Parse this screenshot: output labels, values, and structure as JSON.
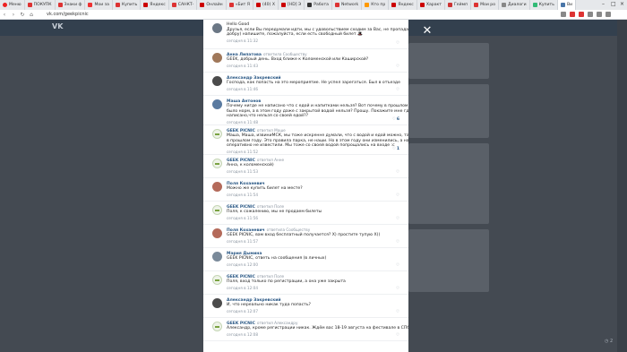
{
  "browser": {
    "menu_label": "Меню",
    "tabs": [
      {
        "label": "ПОКУПК",
        "color": "#d33"
      },
      {
        "label": "Знаки ф",
        "color": "#d33"
      },
      {
        "label": "Мои за",
        "color": "#e33"
      },
      {
        "label": "Купить",
        "color": "#d33"
      },
      {
        "label": "Яндекс",
        "color": "#c00"
      },
      {
        "label": "САНКТ-",
        "color": "#d33"
      },
      {
        "label": "Онлайн",
        "color": "#c00"
      },
      {
        "label": "«Бит Я",
        "color": "#d33"
      },
      {
        "label": "(40) Х",
        "color": "#c00"
      },
      {
        "label": "[HD] Э",
        "color": "#c00"
      },
      {
        "label": "Работа",
        "color": "#333"
      },
      {
        "label": "Network",
        "color": "#d33"
      },
      {
        "label": "Кто пр",
        "color": "#f90"
      },
      {
        "label": "Яндекс",
        "color": "#c00"
      },
      {
        "label": "Характ",
        "color": "#c00"
      },
      {
        "label": "Геймп",
        "color": "#c33"
      },
      {
        "label": "Мои ро",
        "color": "#d33"
      },
      {
        "label": "Диалоги",
        "color": "#888"
      },
      {
        "label": "Купить",
        "color": "#3b7"
      },
      {
        "label": "Ви",
        "color": "#4a76a8"
      }
    ],
    "url": "vk.com/geekpicnic"
  },
  "modal": {
    "comments": [
      {
        "name": "",
        "text": [
          "Hello Good",
          "Друзья, если Вы передумали идти, мы с удовольствием сходим за Вас, не пропадать же",
          "добру) напишите, пожалуйста, если есть свободный билет 🎩"
        ],
        "date": "сегодня в 11:32",
        "avatar": "#6b7785",
        "likes": ""
      },
      {
        "name": "Анна Липатова",
        "answer": "ответила Сообществу",
        "text": [
          "GEEK, добрый день. Вход ближе к Коломенской или Каширской?"
        ],
        "date": "сегодня в 11:43",
        "avatar": "#a0785a",
        "likes": ""
      },
      {
        "name": "Александр Закревский",
        "text": [
          "Господа, как попасть на это мероприятие. Не успел зарегаться. Был в отъезде"
        ],
        "date": "сегодня в 11:46",
        "avatar": "#4b4b4b",
        "likes": ""
      },
      {
        "name": "Маша Антонов",
        "text": [
          "Почему нигде не написано что с едой и напитками нельзя? Вот почему в прошлом году все",
          "было норм, а в этом году даже с закрытой водой нельзя? Прошу. Покажите мне где",
          "написано,что нельзя со своей едой??"
        ],
        "date": "сегодня в 11:48",
        "avatar": "#5a7aa0",
        "likes": "6"
      },
      {
        "name": "GEEK PICNIC",
        "answer": "ответил Маше",
        "text": [
          "Маша, Маша, извиниМСК, мы тоже искренне думали, что с водой и едой можно, так было",
          "в прошлом году. Это правила парка, не наши. Но в этом году они изменились, а нас",
          "оперативно не известили. Мы тоже со своей водой попрощались на входе :c"
        ],
        "date": "сегодня в 11:52",
        "avatar": "gp",
        "likes": "1"
      },
      {
        "name": "GEEK PICNIC",
        "answer": "ответил Анне",
        "text": [
          "Анна, к коломенской)"
        ],
        "date": "сегодня в 11:53",
        "avatar": "gp",
        "likes": ""
      },
      {
        "name": "Поля Коханевич",
        "text": [
          "Можно же купить билет на месте?"
        ],
        "date": "сегодня в 11:54",
        "avatar": "#b46a5a",
        "likes": ""
      },
      {
        "name": "GEEK PICNIC",
        "answer": "ответил Поле",
        "text": [
          "Поля, к сожалению, мы не продаем билеты"
        ],
        "date": "сегодня в 11:56",
        "avatar": "gp",
        "likes": ""
      },
      {
        "name": "Поля Коханевич",
        "answer": "ответила Сообществу",
        "text": [
          "GEEK PICNIC, вам вход бесплатный получается? Х) простите тупую Х))"
        ],
        "date": "сегодня в 11:57",
        "avatar": "#b46a5a",
        "likes": ""
      },
      {
        "name": "Мария Дымина",
        "text": [
          "GEEK PICNIC, ответь на сообщения (в личных)"
        ],
        "date": "сегодня в 12:00",
        "avatar": "#7a8a9a",
        "likes": ""
      },
      {
        "name": "GEEK PICNIC",
        "answer": "ответил Поле",
        "text": [
          "Поля, вход только по регистрации, а она уже закрыта"
        ],
        "date": "сегодня в 12:04",
        "avatar": "gp",
        "likes": ""
      },
      {
        "name": "Александр Закревский",
        "text": [
          "И, что нереально никак туда попасть?"
        ],
        "date": "сегодня в 12:07",
        "avatar": "#4b4b4b",
        "likes": ""
      },
      {
        "name": "GEEK PICNIC",
        "answer": "ответил Александру",
        "text": [
          "Александр, кроме регистрации никак. Ждём вас 18-19 августа на фестивале в СПб."
        ],
        "date": "сегодня в 12:08",
        "avatar": "gp",
        "likes": ""
      }
    ]
  },
  "background": {
    "logo": "VK",
    "nav_items": [
      "",
      "",
      "",
      "",
      "",
      "",
      "",
      "",
      "",
      "",
      "",
      "",
      "",
      ""
    ]
  }
}
